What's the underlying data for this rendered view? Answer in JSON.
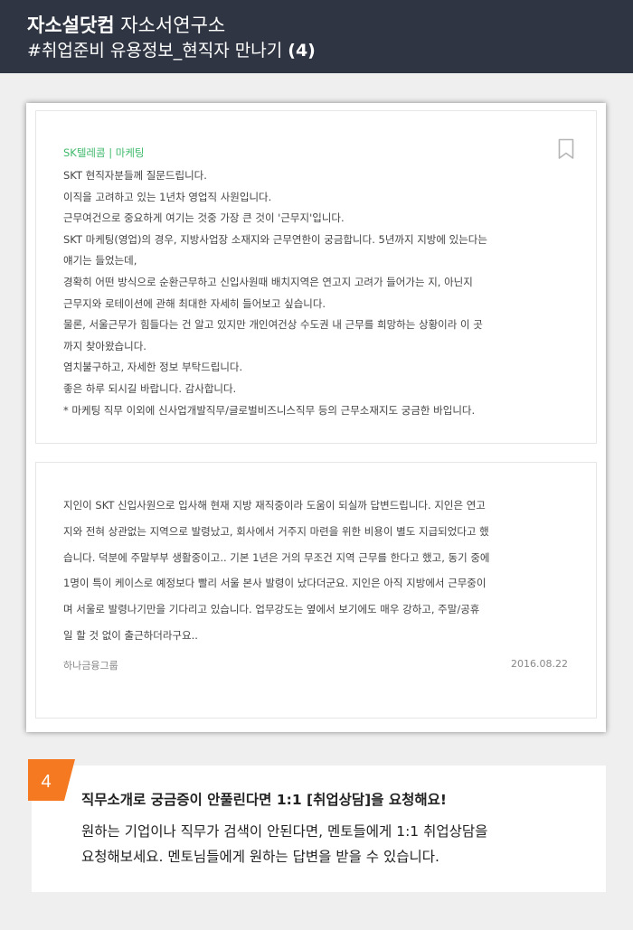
{
  "header": {
    "brand": "자소설닷컴",
    "subtitle": "자소서연구소",
    "series": "#취업준비 유용정보_현직자 만나기",
    "number": "(4)"
  },
  "question": {
    "company": "SK텔레콤 | 마케팅",
    "lines": [
      "SKT 현직자분들께 질문드립니다.",
      "이직을 고려하고 있는 1년차 영업직 사원입니다.",
      "근무여건으로 중요하게 여기는 것중 가장 큰 것이 '근무지'입니다.",
      "SKT 마케팅(영업)의 경우, 지방사업장 소재지와 근무연한이 궁금합니다. 5년까지 지방에 있는다는",
      "얘기는 들었는데,",
      "경확히 어떤 방식으로 순환근무하고 신입사원때 배치지역은 연고지 고려가 들어가는 지, 아닌지",
      "근무지와 로테이션에 관해 최대한 자세히 들어보고 싶습니다.",
      "물론, 서울근무가 힘들다는 건 알고 있지만 개인여건상 수도권 내 근무를 희망하는 상황이라 이 곳",
      "까지 찾아왔습니다.",
      "염치불구하고, 자세한 정보 부탁드립니다.",
      "좋은 하루 되시길 바랍니다. 감사합니다.",
      "* 마케팅 직무 이외에 신사업개발직무/글로벌비즈니스직무 등의 근무소재지도 궁금한 바입니다."
    ]
  },
  "answer": {
    "lines": [
      "지인이 SKT 신입사원으로 입사해 현재 지방 재직중이라 도움이 되실까 답변드립니다. 지인은 연고",
      "지와 전혀 상관없는 지역으로 발령났고, 회사에서 거주지 마련을 위한 비용이 별도 지급되었다고 했",
      "습니다. 덕분에 주말부부 생활중이고.. 기본 1년은 거의 무조건 지역 근무를 한다고 했고, 동기 중에",
      "1명이 특이 케이스로 예정보다 빨리 서울 본사 발령이 났다더군요. 지인은 아직 지방에서 근무중이",
      "며 서울로 발령나기만을 기다리고 있습니다. 업무강도는 옆에서 보기에도 매우 강하고, 주말/공휴",
      "일 할 것 없이 출근하더라구요.."
    ],
    "source": "하나금융그룹",
    "date": "2016.08.22"
  },
  "tip": {
    "number": "4",
    "title": "직무소개로 궁금증이 안풀린다면 1:1 [취업상담]을 요청해요!",
    "lines": [
      "원하는 기업이나 직무가 검색이 안된다면, 멘토들에게 1:1 취업상담을",
      "요청해보세요. 멘토님들에게 원하는 답변을 받을 수 있습니다."
    ],
    "badge_color": "#f47920"
  },
  "icons": {
    "bookmark": "bookmark-icon"
  }
}
